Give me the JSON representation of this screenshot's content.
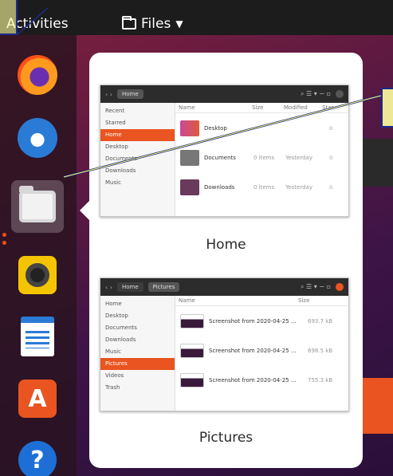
{
  "topbar": {
    "activities_label": "Activities",
    "app_menu_label": "Files",
    "app_menu_icon": "folder-icon",
    "app_menu_caret": "caret-down-icon"
  },
  "dock": {
    "apps": [
      "firefox",
      "thunderbird",
      "files",
      "rhythmbox",
      "libreoffice-writer",
      "ubuntu-software",
      "help"
    ],
    "active_app": "files",
    "running_indicator_color": "#e95420"
  },
  "switcher": {
    "windows": [
      {
        "caption": "Home",
        "path": [
          "Home"
        ],
        "sidebar": [
          "Recent",
          "Starred",
          "Home",
          "Desktop",
          "Documents",
          "Downloads",
          "Music"
        ],
        "sidebar_selected": "Home",
        "columns": [
          "Name",
          "Size",
          "Modified",
          "Star"
        ],
        "rows": [
          {
            "name": "Desktop",
            "size": "",
            "modified": ""
          },
          {
            "name": "Documents",
            "size": "0 items",
            "modified": "Yesterday"
          },
          {
            "name": "Downloads",
            "size": "0 items",
            "modified": "Yesterday"
          }
        ]
      },
      {
        "caption": "Pictures",
        "path": [
          "Home",
          "Pictures"
        ],
        "sidebar": [
          "Home",
          "Desktop",
          "Documents",
          "Downloads",
          "Music",
          "Pictures",
          "Videos",
          "Trash"
        ],
        "sidebar_selected": "Pictures",
        "columns": [
          "Name",
          "Size"
        ],
        "rows": [
          {
            "name": "Screenshot from 2020-04-25 ...",
            "size": "693.7 kB"
          },
          {
            "name": "Screenshot from 2020-04-25 ...",
            "size": "698.5 kB"
          },
          {
            "name": "Screenshot from 2020-04-25 ...",
            "size": "755.3 kB"
          }
        ]
      }
    ]
  },
  "colors": {
    "accent": "#e95420",
    "topbar": "#1c1c1c",
    "annotation_box": "#ffffa0",
    "annotation_line": "#1a2a8c"
  }
}
